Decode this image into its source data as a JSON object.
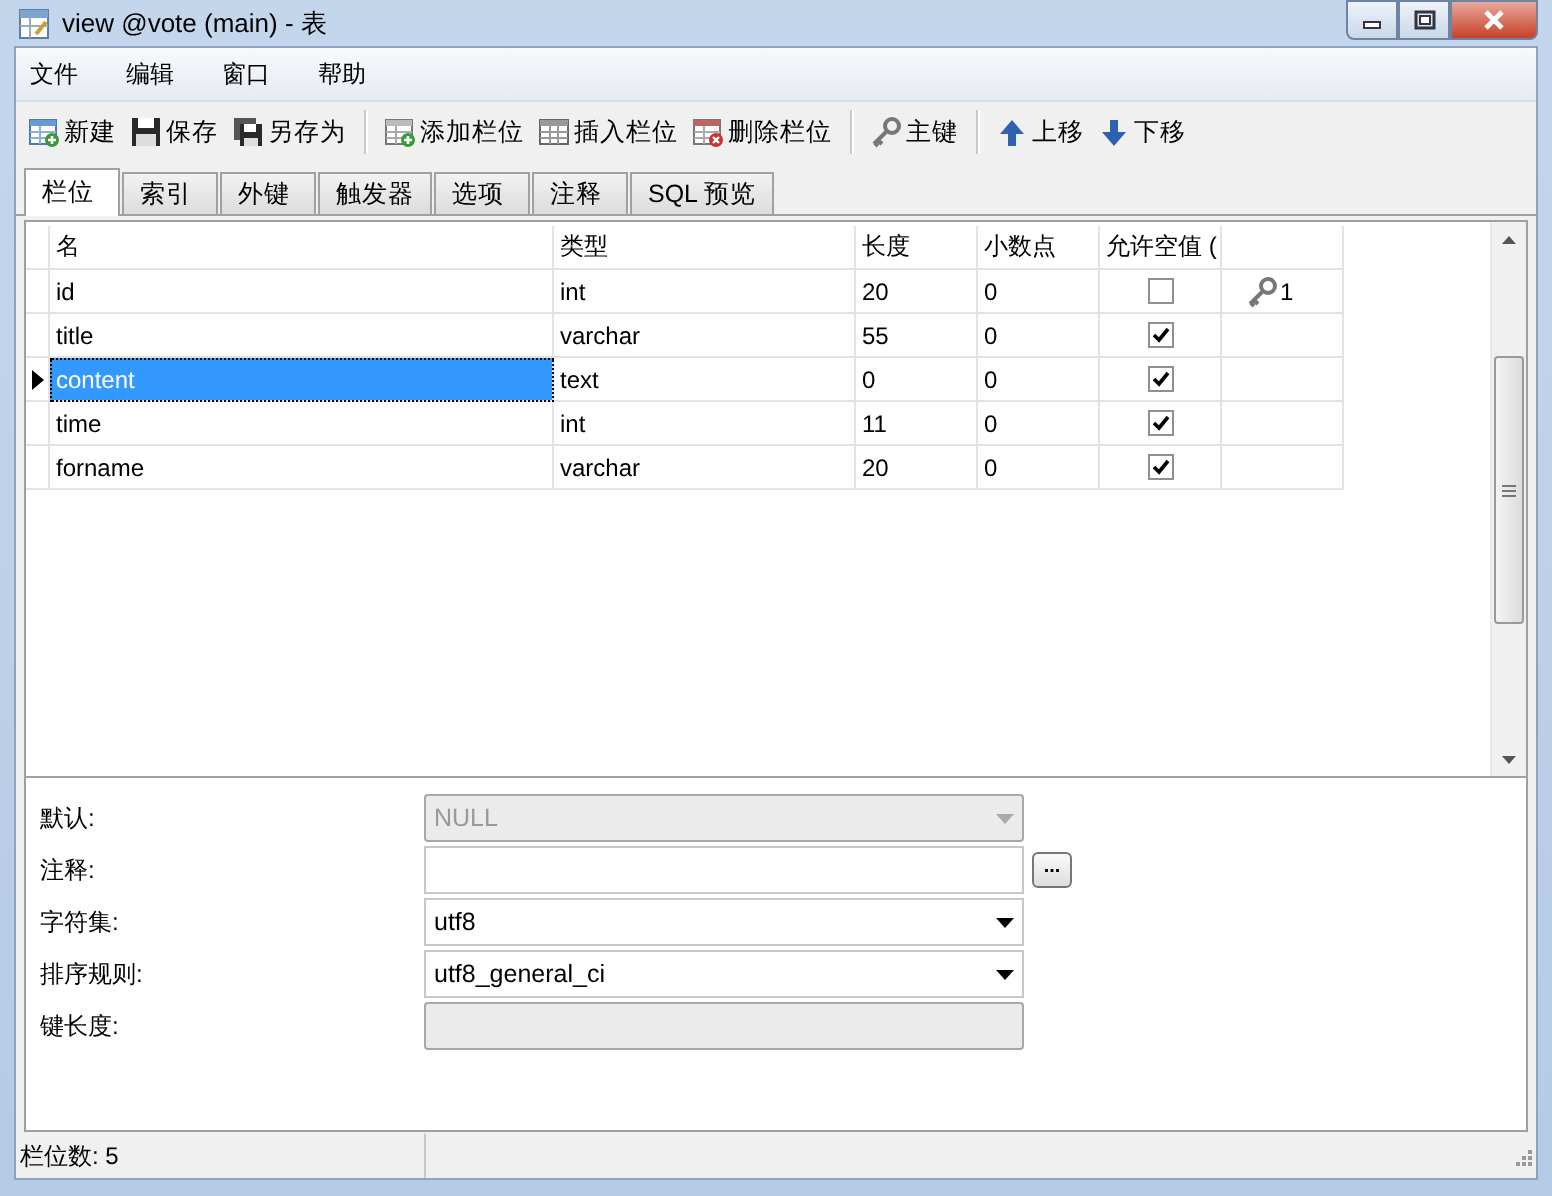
{
  "window": {
    "title": "view @vote (main) - 表"
  },
  "menu": [
    {
      "label": "文件"
    },
    {
      "label": "编辑"
    },
    {
      "label": "窗口"
    },
    {
      "label": "帮助"
    }
  ],
  "toolbar": [
    {
      "items": [
        {
          "label": "新建",
          "kind": "new"
        },
        {
          "label": "保存",
          "kind": "save"
        },
        {
          "label": "另存为",
          "kind": "save_as"
        }
      ]
    },
    {
      "items": [
        {
          "label": "添加栏位",
          "kind": "add_column"
        },
        {
          "label": "插入栏位",
          "kind": "insert_column"
        },
        {
          "label": "删除栏位",
          "kind": "delete_column"
        }
      ]
    },
    {
      "items": [
        {
          "label": "主键",
          "kind": "key"
        }
      ]
    },
    {
      "items": [
        {
          "label": "上移",
          "kind": "up"
        },
        {
          "label": "下移",
          "kind": "down"
        }
      ]
    }
  ],
  "tabs": [
    {
      "label": "栏位",
      "selected": true
    },
    {
      "label": "索引",
      "selected": false
    },
    {
      "label": "外键",
      "selected": false
    },
    {
      "label": "触发器",
      "selected": false
    },
    {
      "label": "选项",
      "selected": false
    },
    {
      "label": "注释",
      "selected": false
    },
    {
      "label": "SQL 预览",
      "selected": false
    }
  ],
  "table": {
    "columns": [
      "名",
      "类型",
      "长度",
      "小数点",
      "允许空值 ("
    ],
    "rows": [
      {
        "name": "id",
        "type": "int",
        "length": "20",
        "decimals": "0",
        "allow_null": false,
        "key": "1",
        "selected": false
      },
      {
        "name": "title",
        "type": "varchar",
        "length": "55",
        "decimals": "0",
        "allow_null": true,
        "selected": false
      },
      {
        "name": "content",
        "type": "text",
        "length": "0",
        "decimals": "0",
        "allow_null": true,
        "selected": true
      },
      {
        "name": "time",
        "type": "int",
        "length": "11",
        "decimals": "0",
        "allow_null": true,
        "selected": false
      },
      {
        "name": "forname",
        "type": "varchar",
        "length": "20",
        "decimals": "0",
        "allow_null": true,
        "selected": false
      }
    ]
  },
  "properties": [
    {
      "label": "默认:",
      "kind": "dropdown",
      "value": "NULL",
      "disabled": true
    },
    {
      "label": "注释:",
      "kind": "text_with_button",
      "button": "...",
      "disabled": false
    },
    {
      "label": "字符集:",
      "kind": "dropdown",
      "value": "utf8",
      "disabled": false
    },
    {
      "label": "排序规则:",
      "kind": "dropdown",
      "value": "utf8_general_ci",
      "disabled": false
    },
    {
      "label": "键长度:",
      "kind": "text",
      "disabled": true
    }
  ],
  "status_bar": {
    "text": "栏位数: 5"
  }
}
